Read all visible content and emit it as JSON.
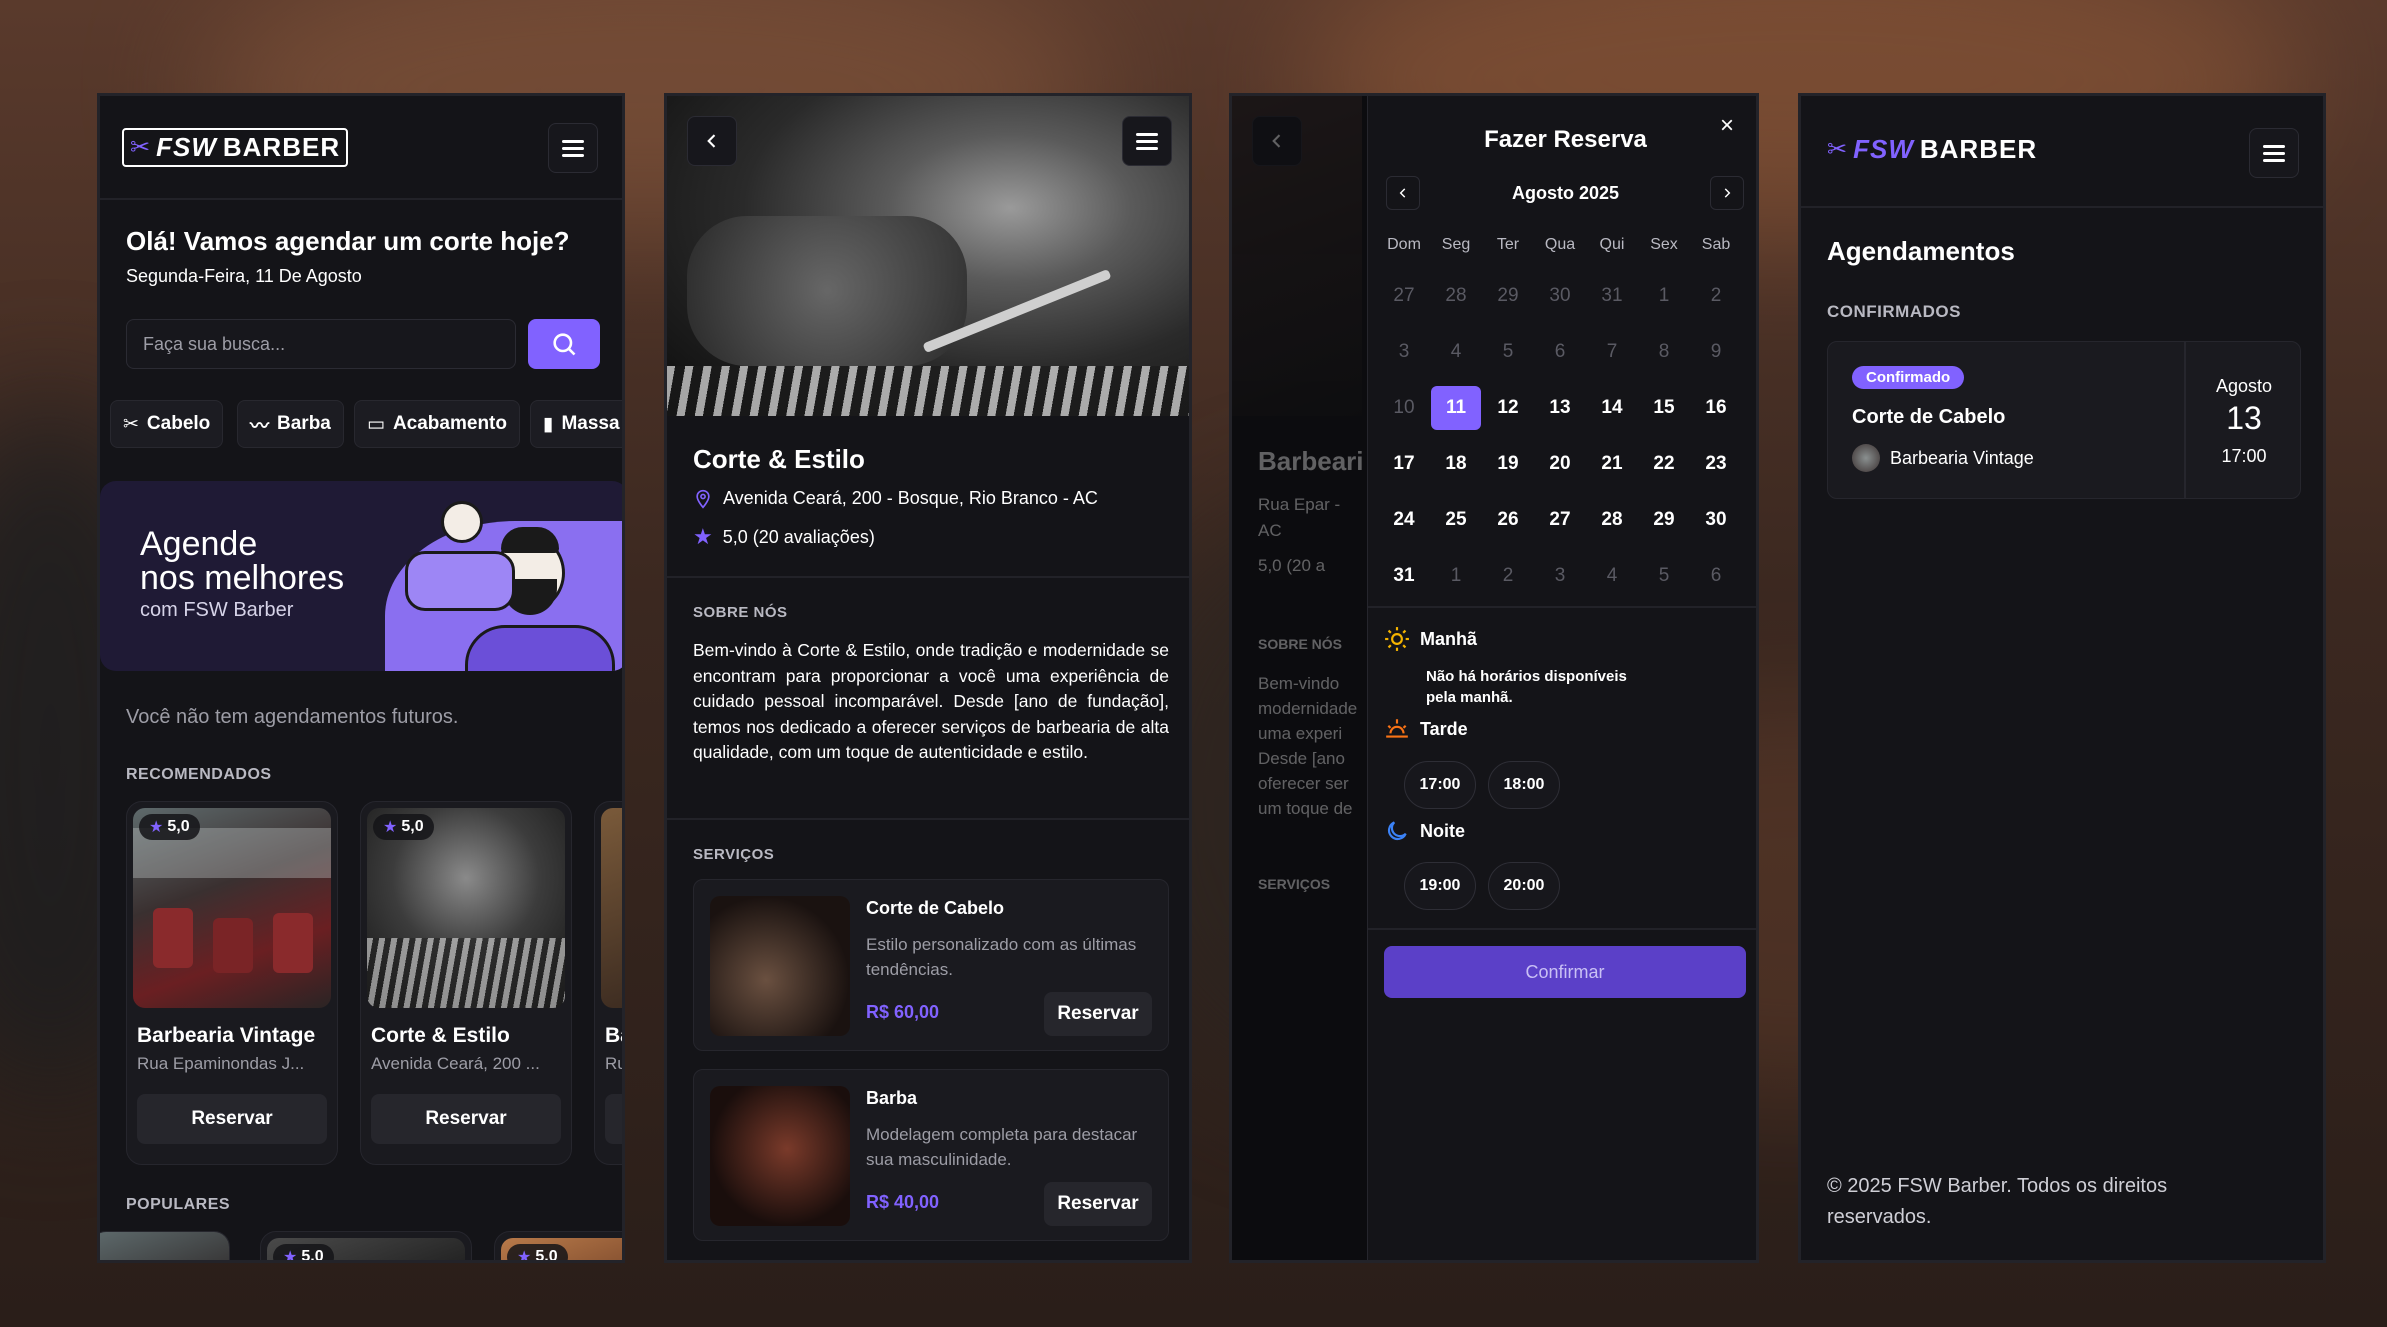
{
  "colors": {
    "accent": "#8162ff",
    "bg": "#141418",
    "card": "#1a1a1f"
  },
  "home": {
    "logo_fsw": "FSW",
    "logo_barber": "BARBER",
    "greeting": "Olá! Vamos agendar um corte hoje?",
    "date": "Segunda-Feira, 11 De Agosto",
    "search_placeholder": "Faça sua busca...",
    "categories": [
      "Cabelo",
      "Barba",
      "Acabamento",
      "Massa"
    ],
    "banner_line1": "Agende",
    "banner_line2": "nos melhores",
    "banner_line3": "com FSW Barber",
    "no_bookings": "Você não tem agendamentos futuros.",
    "recommended_title": "RECOMENDADOS",
    "popular_title": "POPULARES",
    "shops": [
      {
        "name": "Barbearia Vintage",
        "address": "Rua Epaminondas J...",
        "rating": "5,0",
        "button": "Reservar"
      },
      {
        "name": "Corte & Estilo",
        "address": "Avenida Ceará, 200 ...",
        "rating": "5,0",
        "button": "Reservar"
      },
      {
        "name": "Ba",
        "address": "Ru"
      }
    ],
    "popular_ratings": [
      "5,0",
      "5,0"
    ]
  },
  "shop": {
    "name": "Corte & Estilo",
    "address": "Avenida Ceará, 200 - Bosque, Rio Branco - AC",
    "rating": "5,0 (20 avaliações)",
    "about_title": "SOBRE NÓS",
    "about_text": "Bem-vindo à Corte & Estilo, onde tradição e modernidade se encontram para proporcionar a você uma experiência de cuidado pessoal incomparável. Desde [ano de fundação], temos nos dedicado a oferecer serviços de barbearia de alta qualidade, com um toque de autenticidade e estilo.",
    "services_title": "SERVIÇOS",
    "services": [
      {
        "name": "Corte de Cabelo",
        "desc": "Estilo personalizado com as últimas tendências.",
        "price": "R$ 60,00",
        "button": "Reservar"
      },
      {
        "name": "Barba",
        "desc": "Modelagem completa para destacar sua masculinidade.",
        "price": "R$ 40,00",
        "button": "Reservar"
      }
    ]
  },
  "booking": {
    "title": "Fazer Reserva",
    "month": "Agosto 2025",
    "weekdays": [
      "Dom",
      "Seg",
      "Ter",
      "Qua",
      "Qui",
      "Sex",
      "Sab"
    ],
    "weeks": [
      [
        "27",
        "28",
        "29",
        "30",
        "31",
        "1",
        "2"
      ],
      [
        "3",
        "4",
        "5",
        "6",
        "7",
        "8",
        "9"
      ],
      [
        "10",
        "11",
        "12",
        "13",
        "14",
        "15",
        "16"
      ],
      [
        "17",
        "18",
        "19",
        "20",
        "21",
        "22",
        "23"
      ],
      [
        "24",
        "25",
        "26",
        "27",
        "28",
        "29",
        "30"
      ],
      [
        "31",
        "1",
        "2",
        "3",
        "4",
        "5",
        "6"
      ]
    ],
    "selected_day": "11",
    "morning_label": "Manhã",
    "morning_empty": "Não há horários disponíveis pela manhã.",
    "afternoon_label": "Tarde",
    "afternoon_slots": [
      "17:00",
      "18:00"
    ],
    "night_label": "Noite",
    "night_slots": [
      "19:00",
      "20:00"
    ],
    "confirm": "Confirmar",
    "behind_shop_name": "Barbeari",
    "behind_address": "Rua Epar - AC",
    "behind_rating": "5,0 (20 a",
    "behind_about": "SOBRE NÓS",
    "behind_text": "Bem-vindo modernidade uma experi Desde [ano oferecer ser um toque de",
    "behind_services": "SERVIÇOS"
  },
  "appointments": {
    "title": "Agendamentos",
    "confirmed_title": "CONFIRMADOS",
    "badge": "Confirmado",
    "service": "Corte de Cabelo",
    "shop": "Barbearia Vintage",
    "month": "Agosto",
    "day": "13",
    "time": "17:00",
    "footer": "© 2025 FSW Barber. Todos os direitos reservados."
  }
}
